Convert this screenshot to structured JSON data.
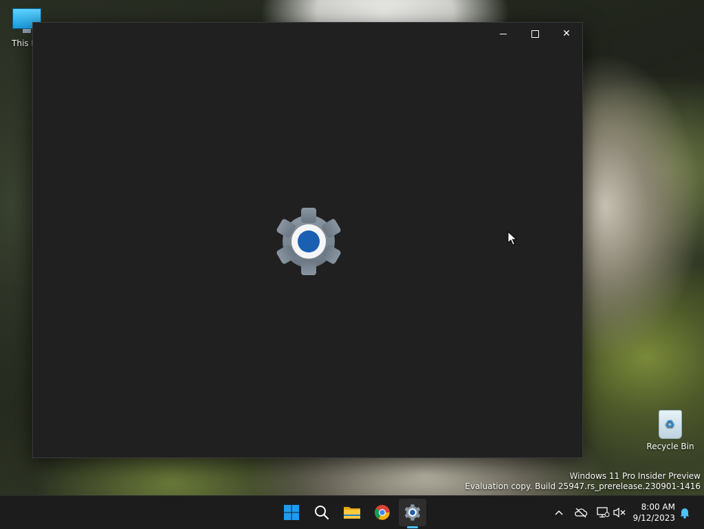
{
  "desktop": {
    "icons": [
      {
        "label": "This PC"
      },
      {
        "label": "Recycle Bin"
      }
    ]
  },
  "window": {
    "caption": {
      "minimize_glyph": "minimize-icon",
      "maximize_glyph": "maximize-icon",
      "close_glyph": "✕"
    },
    "splash_icon": "settings-gear-icon"
  },
  "watermark": {
    "line1": "Windows 11 Pro Insider Preview",
    "line2": "Evaluation copy. Build 25947.rs_prerelease.230901-1416"
  },
  "taskbar": {
    "items": [
      {
        "icon": "windows-start-icon"
      },
      {
        "icon": "search-icon"
      },
      {
        "icon": "file-explorer-icon"
      },
      {
        "icon": "chrome-icon"
      },
      {
        "icon": "settings-icon",
        "active": true
      }
    ],
    "tray": {
      "chevron": "^",
      "clock_time": "8:00 AM",
      "clock_date": "9/12/2023"
    }
  },
  "colors": {
    "window_bg": "#202020",
    "taskbar_bg": "#1c1c1c",
    "accent": "#4cc2ff",
    "gear_blue": "#1b5fb3",
    "gear_grey": "#7e8a96"
  }
}
